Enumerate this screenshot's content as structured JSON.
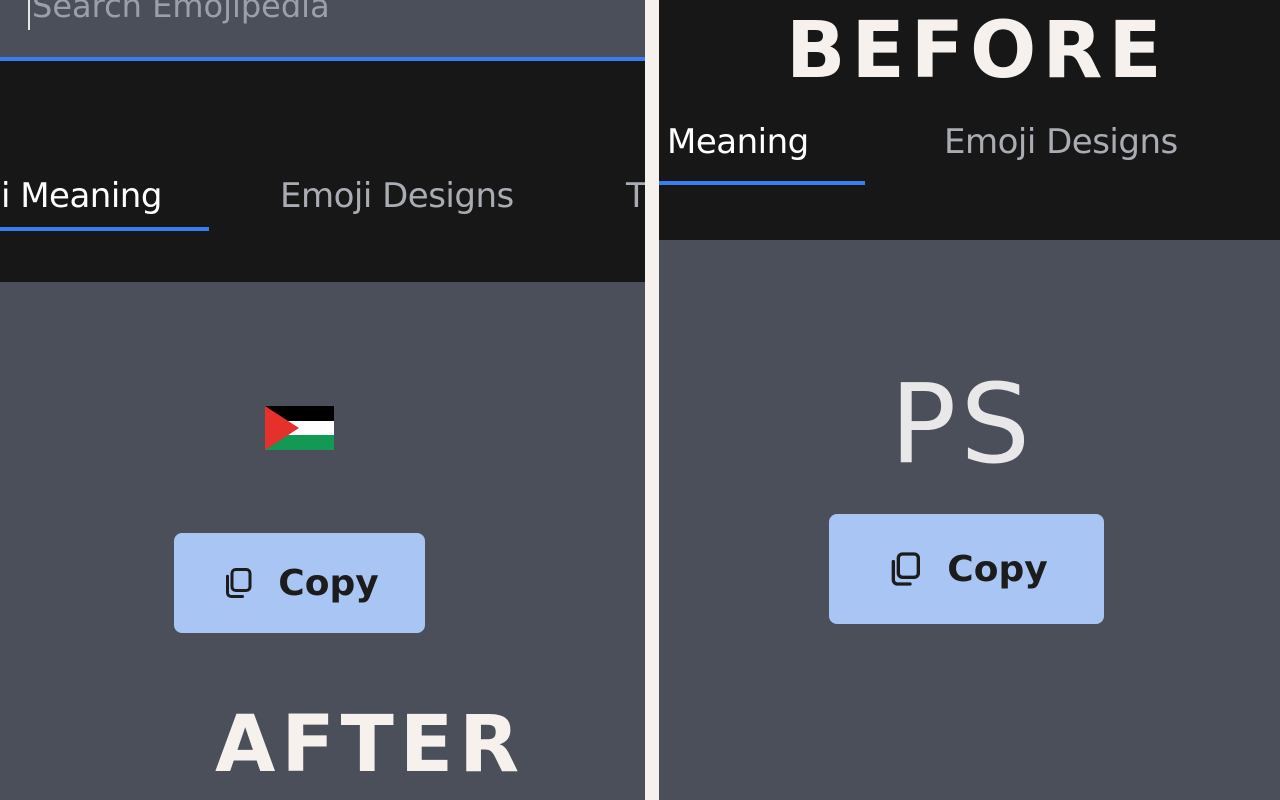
{
  "after_panel": {
    "search": {
      "placeholder": "Search Emojipedia"
    },
    "tabs": [
      {
        "label": "ji Meaning",
        "active": true
      },
      {
        "label": "Emoji Designs",
        "active": false
      },
      {
        "label": "T",
        "active": false
      }
    ],
    "emoji": {
      "name": "flag-palestinian-territories",
      "colors": [
        "#000000",
        "#ffffff",
        "#149954",
        "#e4312b"
      ]
    },
    "copy_button": {
      "label": "Copy",
      "icon": "copy-icon"
    },
    "caption": "AFTER"
  },
  "before_panel": {
    "caption": "BEFORE",
    "tabs": [
      {
        "label": "Meaning",
        "active": true
      },
      {
        "label": "Emoji Designs",
        "active": false
      }
    ],
    "emoji_fallback_text": "PS",
    "copy_button": {
      "label": "Copy",
      "icon": "copy-icon"
    }
  },
  "colors": {
    "panel_bg": "#4a4f5a",
    "tabbar_bg": "#171717",
    "accent": "#3b7cf0",
    "copy_button_bg": "#a9c5f3",
    "caption_text": "#f6f1ec"
  }
}
